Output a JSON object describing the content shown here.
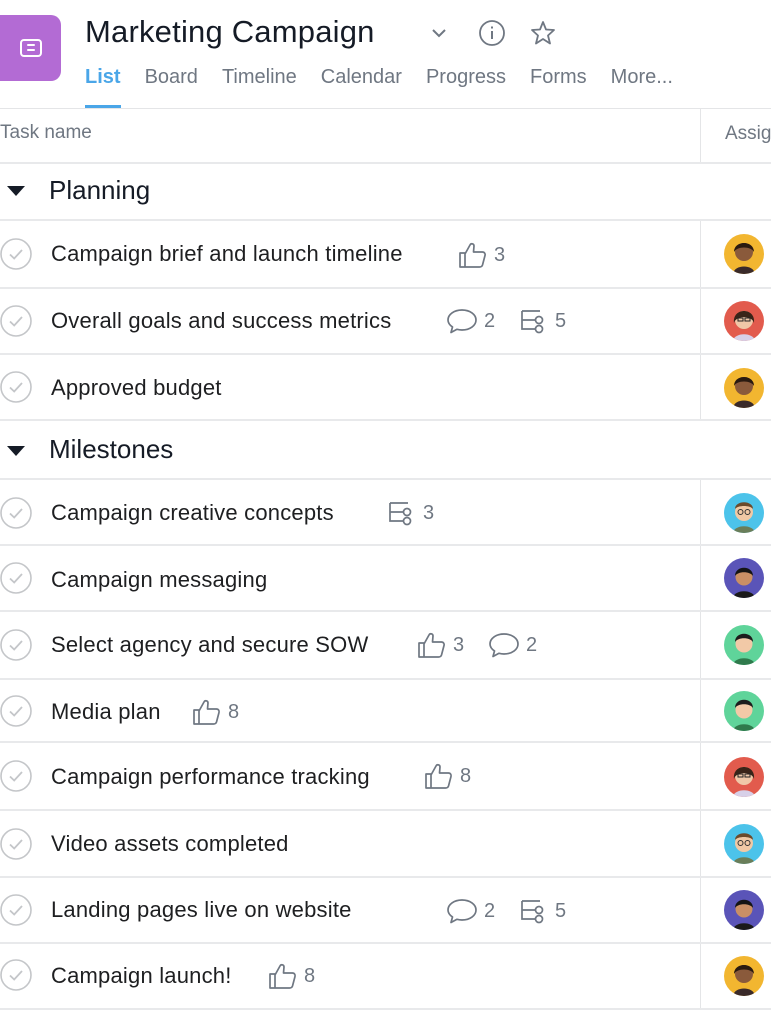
{
  "project": {
    "title": "Marketing Campaign",
    "icon": "list-icon",
    "color": "#b36bd4"
  },
  "tabs": [
    {
      "label": "List",
      "active": true
    },
    {
      "label": "Board"
    },
    {
      "label": "Timeline"
    },
    {
      "label": "Calendar"
    },
    {
      "label": "Progress"
    },
    {
      "label": "Forms"
    },
    {
      "label": "More..."
    }
  ],
  "columns": {
    "task_name": "Task name",
    "assignee": "Assig"
  },
  "sections": [
    {
      "label": "Planning"
    },
    {
      "label": "Milestones"
    }
  ],
  "tasks": [
    {
      "name": "Campaign brief and launch timeline",
      "likes": "3",
      "avatar": "orange"
    },
    {
      "name": "Overall goals and success metrics",
      "comments": "2",
      "subtasks": "5",
      "avatar": "red"
    },
    {
      "name": "Approved budget",
      "avatar": "orange"
    },
    {
      "name": "Campaign creative concepts",
      "subtasks": "3",
      "avatar": "blue"
    },
    {
      "name": "Campaign messaging",
      "avatar": "purple"
    },
    {
      "name": "Select agency and secure SOW",
      "likes": "3",
      "comments": "2",
      "avatar": "green"
    },
    {
      "name": "Media plan",
      "likes": "8",
      "avatar": "green"
    },
    {
      "name": "Campaign performance tracking",
      "likes": "8",
      "avatar": "red"
    },
    {
      "name": "Video assets completed",
      "avatar": "blue"
    },
    {
      "name": "Landing pages live on website",
      "comments": "2",
      "subtasks": "5",
      "avatar": "purple"
    },
    {
      "name": "Campaign launch!",
      "likes": "8",
      "avatar": "orange"
    }
  ],
  "colors": {
    "accent": "#4aa6e8",
    "muted": "#6f7782",
    "divider": "#e8e9eb"
  }
}
